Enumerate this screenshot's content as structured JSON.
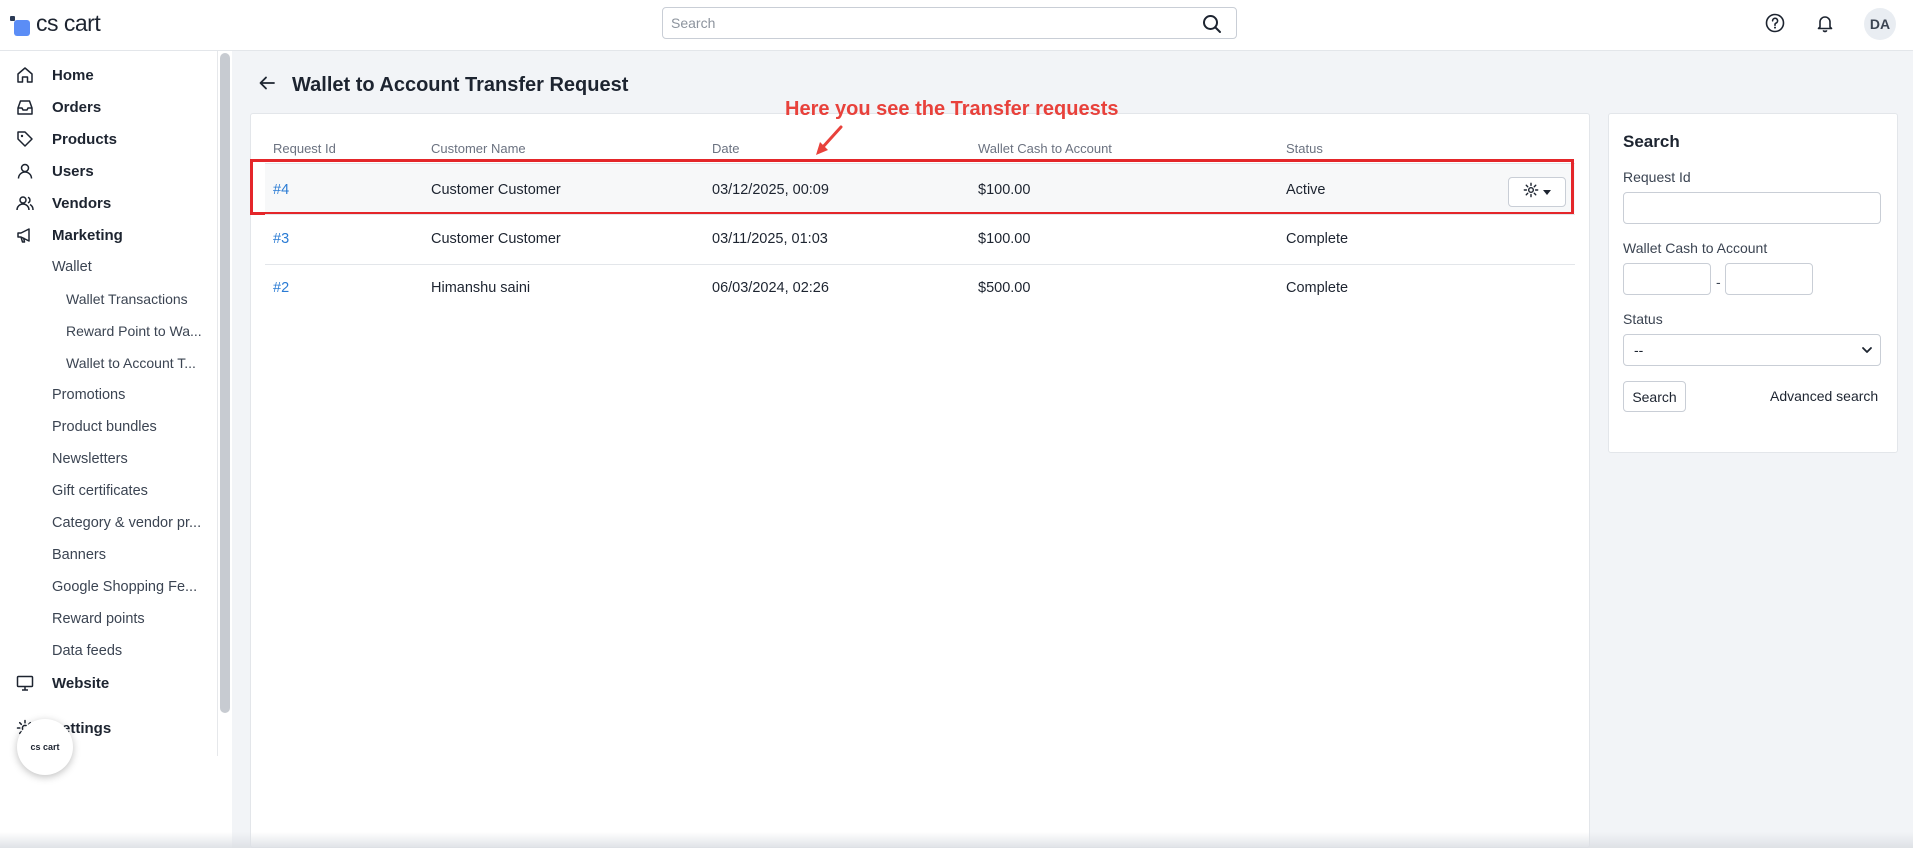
{
  "header": {
    "logo_text": "cs cart",
    "search_placeholder": "Search",
    "avatar_initials": "DA",
    "icons": [
      "help-icon",
      "bell-icon",
      "search-icon"
    ]
  },
  "sidebar": {
    "items": [
      {
        "label": "Home",
        "icon": "home-icon"
      },
      {
        "label": "Orders",
        "icon": "inbox-icon"
      },
      {
        "label": "Products",
        "icon": "tag-icon"
      },
      {
        "label": "Users",
        "icon": "user-icon"
      },
      {
        "label": "Vendors",
        "icon": "users-icon"
      },
      {
        "label": "Marketing",
        "icon": "megaphone-icon"
      },
      {
        "label": "Wallet"
      },
      {
        "label": "Wallet Transactions"
      },
      {
        "label": "Reward Point to Wa..."
      },
      {
        "label": "Wallet to Account T..."
      },
      {
        "label": "Promotions"
      },
      {
        "label": "Product bundles"
      },
      {
        "label": "Newsletters"
      },
      {
        "label": "Gift certificates"
      },
      {
        "label": "Category & vendor pr..."
      },
      {
        "label": "Banners"
      },
      {
        "label": "Google Shopping Fe..."
      },
      {
        "label": "Reward points"
      },
      {
        "label": "Data feeds"
      },
      {
        "label": "Website",
        "icon": "monitor-icon"
      },
      {
        "label": "Settings",
        "icon": "gear-icon"
      }
    ],
    "badge_text": "cs cart"
  },
  "page": {
    "title": "Wallet to Account Transfer Request",
    "annotation": "Here you see the Transfer requests",
    "annotation_color": "#e8413b"
  },
  "table": {
    "headers": [
      "Request Id",
      "Customer Name",
      "Date",
      "Wallet Cash to Account",
      "Status"
    ],
    "rows": [
      {
        "id": "#4",
        "customer": "Customer Customer",
        "date": "03/12/2025, 00:09",
        "amount": "$100.00",
        "status": "Active"
      },
      {
        "id": "#3",
        "customer": "Customer Customer",
        "date": "03/11/2025, 01:03",
        "amount": "$100.00",
        "status": "Complete"
      },
      {
        "id": "#2",
        "customer": "Himanshu saini",
        "date": "06/03/2024, 02:26",
        "amount": "$500.00",
        "status": "Complete"
      }
    ],
    "link_color": "#2a7bd4"
  },
  "search_panel": {
    "title": "Search",
    "request_id_label": "Request Id",
    "amount_label": "Wallet Cash to Account",
    "range_separator": "-",
    "status_label": "Status",
    "status_selected": "--",
    "search_button": "Search",
    "advanced_link": "Advanced search"
  }
}
